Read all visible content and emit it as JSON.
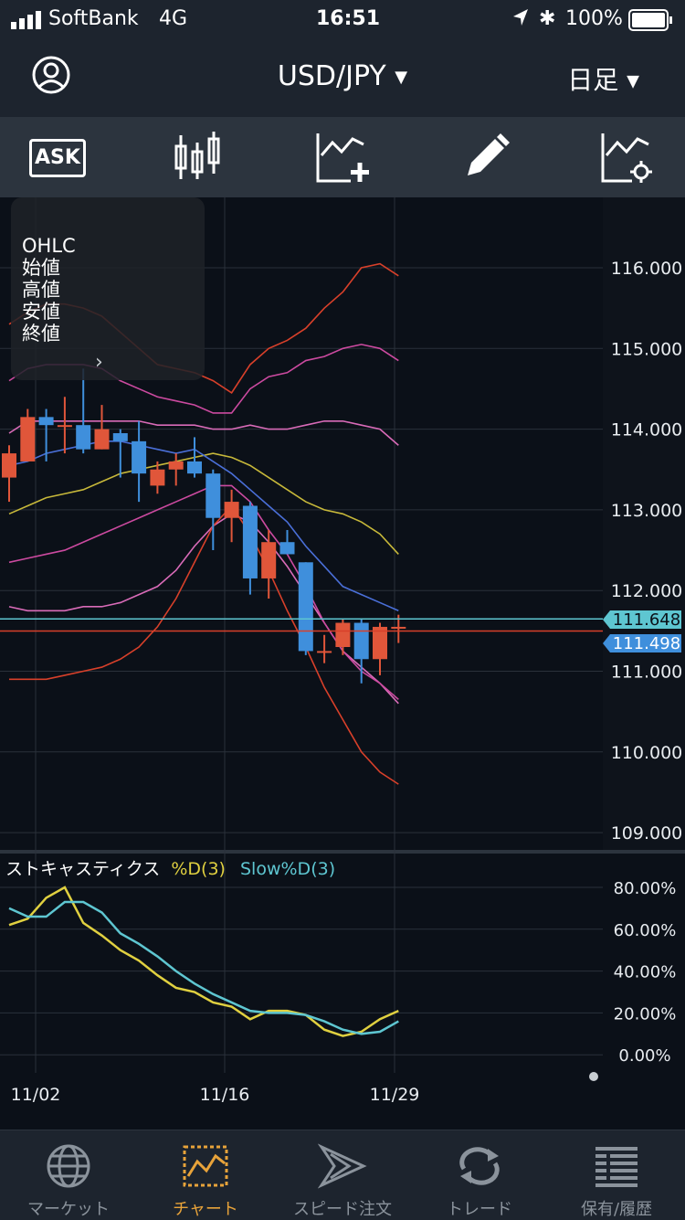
{
  "status_bar": {
    "carrier": "SoftBank",
    "network": "4G",
    "time": "16:51",
    "battery": "100%"
  },
  "header": {
    "title": "USD/JPY",
    "period": "日足"
  },
  "toolbar": {
    "ask_label": "ASK"
  },
  "ohlc_popup": {
    "title": "OHLC",
    "open": "始値",
    "high": "高値",
    "low": "安値",
    "close": "終値"
  },
  "stochastic_legend": {
    "name": "ストキャスティクス",
    "d_label": "%D(3)",
    "slow_label": "Slow%D(3)"
  },
  "current_prices": {
    "ask": "111.648",
    "bid": "111.498"
  },
  "colors": {
    "up": "#e0563a",
    "down": "#3f8fdc",
    "ask_tag": "#5ec6d1",
    "bid_tag": "#3f8fdc",
    "gold": "#e8a33a"
  },
  "chart_data": [
    {
      "type": "candlestick",
      "ylim": [
        109.0,
        116.2
      ],
      "y_ticks": [
        "116.000",
        "115.000",
        "114.000",
        "113.000",
        "112.000",
        "111.000",
        "110.000",
        "109.000"
      ],
      "x_ticks": [
        "11/02",
        "11/16",
        "11/29"
      ],
      "candles": [
        {
          "o": 113.4,
          "h": 113.8,
          "l": 113.1,
          "c": 113.7
        },
        {
          "o": 113.6,
          "h": 114.25,
          "l": 113.6,
          "c": 114.15
        },
        {
          "o": 114.15,
          "h": 114.25,
          "l": 113.6,
          "c": 114.05
        },
        {
          "o": 114.05,
          "h": 114.4,
          "l": 113.7,
          "c": 114.05
        },
        {
          "o": 114.05,
          "h": 114.75,
          "l": 113.7,
          "c": 113.75
        },
        {
          "o": 113.75,
          "h": 114.3,
          "l": 113.75,
          "c": 114.0
        },
        {
          "o": 113.95,
          "h": 114.0,
          "l": 113.4,
          "c": 113.85
        },
        {
          "o": 113.85,
          "h": 114.1,
          "l": 113.1,
          "c": 113.45
        },
        {
          "o": 113.3,
          "h": 113.6,
          "l": 113.2,
          "c": 113.5
        },
        {
          "o": 113.5,
          "h": 113.7,
          "l": 113.3,
          "c": 113.6
        },
        {
          "o": 113.6,
          "h": 113.9,
          "l": 113.4,
          "c": 113.45
        },
        {
          "o": 113.45,
          "h": 113.5,
          "l": 112.5,
          "c": 112.9
        },
        {
          "o": 112.9,
          "h": 113.25,
          "l": 112.6,
          "c": 113.1
        },
        {
          "o": 113.05,
          "h": 113.1,
          "l": 111.95,
          "c": 112.15
        },
        {
          "o": 112.15,
          "h": 112.75,
          "l": 111.9,
          "c": 112.6
        },
        {
          "o": 112.6,
          "h": 112.75,
          "l": 112.45,
          "c": 112.45
        },
        {
          "o": 112.35,
          "h": 112.35,
          "l": 111.2,
          "c": 111.25
        },
        {
          "o": 111.25,
          "h": 111.45,
          "l": 111.1,
          "c": 111.25
        },
        {
          "o": 111.3,
          "h": 111.65,
          "l": 111.2,
          "c": 111.6
        },
        {
          "o": 111.6,
          "h": 111.65,
          "l": 110.85,
          "c": 111.15
        },
        {
          "o": 111.15,
          "h": 111.6,
          "l": 110.95,
          "c": 111.55
        },
        {
          "o": 111.55,
          "h": 111.7,
          "l": 111.35,
          "c": 111.55
        }
      ],
      "bands": [
        {
          "name": "upper-3",
          "color": "#d8402a",
          "values": [
            115.3,
            115.45,
            115.55,
            115.55,
            115.5,
            115.4,
            115.2,
            115.0,
            114.8,
            114.75,
            114.7,
            114.6,
            114.45,
            114.8,
            115.0,
            115.1,
            115.25,
            115.5,
            115.7,
            116.0,
            116.05,
            115.9
          ]
        },
        {
          "name": "upper-2",
          "color": "#cc4aa0",
          "values": [
            114.6,
            114.75,
            114.8,
            114.8,
            114.8,
            114.75,
            114.6,
            114.5,
            114.4,
            114.35,
            114.3,
            114.2,
            114.2,
            114.5,
            114.65,
            114.7,
            114.85,
            114.9,
            115.0,
            115.05,
            115.0,
            114.85
          ]
        },
        {
          "name": "upper-1",
          "color": "#d96bb8",
          "values": [
            113.95,
            114.1,
            114.1,
            114.1,
            114.1,
            114.1,
            114.1,
            114.1,
            114.05,
            114.05,
            114.05,
            114.0,
            114.0,
            114.05,
            114.0,
            114.0,
            114.05,
            114.1,
            114.1,
            114.05,
            114.0,
            113.8
          ]
        },
        {
          "name": "ma-long",
          "color": "#c7b83a",
          "values": [
            112.95,
            113.05,
            113.15,
            113.2,
            113.25,
            113.35,
            113.45,
            113.5,
            113.55,
            113.6,
            113.65,
            113.7,
            113.65,
            113.55,
            113.4,
            113.25,
            113.1,
            113.0,
            112.95,
            112.85,
            112.7,
            112.45
          ]
        },
        {
          "name": "ma-short",
          "color": "#4a6fd8",
          "values": [
            113.55,
            113.6,
            113.7,
            113.75,
            113.8,
            113.85,
            113.85,
            113.8,
            113.75,
            113.7,
            113.75,
            113.6,
            113.45,
            113.25,
            113.05,
            112.85,
            112.55,
            112.3,
            112.05,
            111.95,
            111.85,
            111.75
          ]
        },
        {
          "name": "lower-1",
          "color": "#d96bb8",
          "values": [
            111.8,
            111.75,
            111.75,
            111.75,
            111.8,
            111.8,
            111.85,
            111.95,
            112.05,
            112.25,
            112.55,
            112.8,
            112.95,
            112.85,
            112.6,
            112.3,
            111.95,
            111.6,
            111.25,
            111.05,
            110.85,
            110.6
          ]
        },
        {
          "name": "lower-2",
          "color": "#cc4aa0",
          "values": [
            112.35,
            112.4,
            112.45,
            112.5,
            112.6,
            112.7,
            112.8,
            112.9,
            113.0,
            113.1,
            113.2,
            113.3,
            113.3,
            113.1,
            112.75,
            112.45,
            112.05,
            111.6,
            111.25,
            111.0,
            110.85,
            110.65
          ]
        },
        {
          "name": "lower-3",
          "color": "#d8402a",
          "values": [
            110.9,
            110.9,
            110.9,
            110.95,
            111.0,
            111.05,
            111.15,
            111.3,
            111.55,
            111.9,
            112.35,
            112.8,
            113.05,
            112.7,
            112.25,
            111.75,
            111.3,
            110.8,
            110.4,
            110.0,
            109.75,
            109.6
          ]
        }
      ],
      "h_lines": [
        {
          "value": 111.648,
          "color": "#5ec6d1"
        },
        {
          "value": 111.498,
          "color": "#d8402a"
        }
      ]
    },
    {
      "type": "line",
      "ylim": [
        0,
        88
      ],
      "y_ticks": [
        "80.00%",
        "60.00%",
        "40.00%",
        "20.00%",
        "0.00%"
      ],
      "series": [
        {
          "name": "%D(3)",
          "color": "#e0d040",
          "values": [
            62,
            65,
            75,
            80,
            63,
            57,
            50,
            45,
            38,
            32,
            30,
            25,
            23,
            17,
            21,
            21,
            19,
            12,
            9,
            11,
            17,
            21
          ]
        },
        {
          "name": "Slow%D(3)",
          "color": "#5ec6d1",
          "values": [
            70,
            66,
            66,
            73,
            73,
            68,
            58,
            53,
            47,
            40,
            34,
            29,
            25,
            21,
            20,
            20,
            19,
            16,
            12,
            10,
            11,
            16
          ]
        }
      ]
    }
  ],
  "tabs": [
    {
      "id": "market",
      "label": "マーケット"
    },
    {
      "id": "chart",
      "label": "チャート"
    },
    {
      "id": "speed",
      "label": "スピード注文"
    },
    {
      "id": "trade",
      "label": "トレード"
    },
    {
      "id": "history",
      "label": "保有/履歴"
    }
  ]
}
